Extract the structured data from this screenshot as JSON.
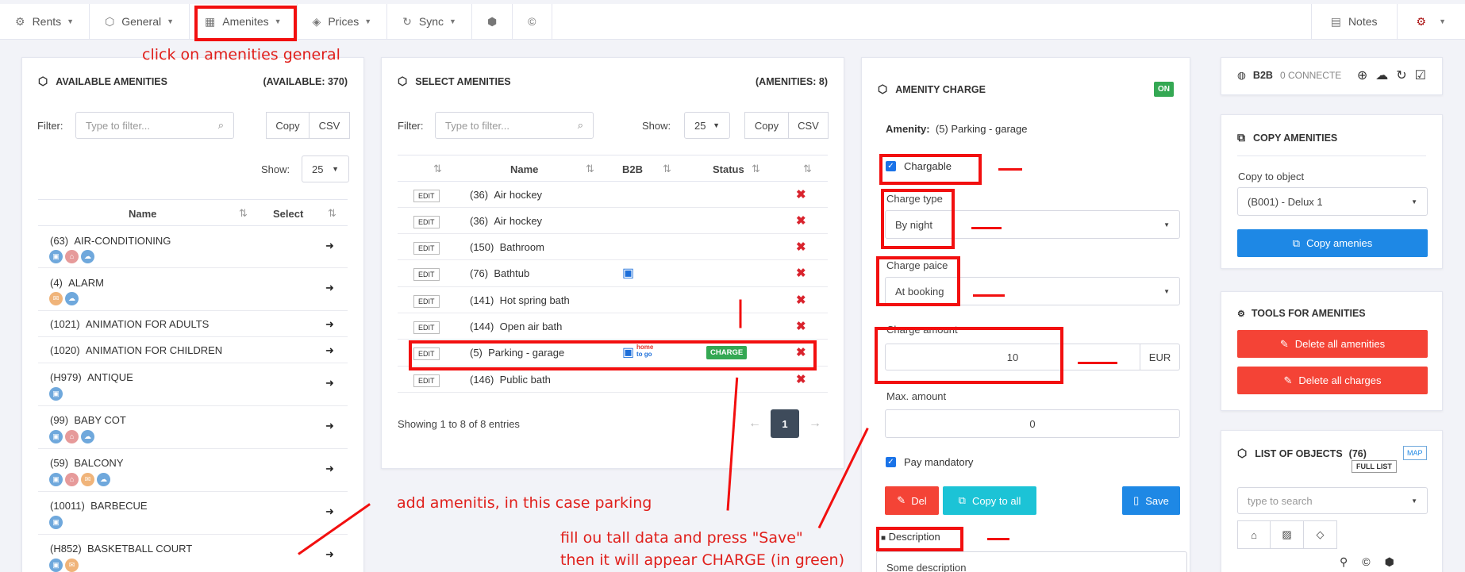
{
  "nav": {
    "rents": "Rents",
    "general": "General",
    "amenities": "Amenites",
    "prices": "Prices",
    "sync": "Sync",
    "notes": "Notes"
  },
  "available": {
    "title": "AVAILABLE AMENITIES",
    "count": "(AVAILABLE: 370)",
    "filter_label": "Filter:",
    "filter_placeholder": "Type to filter...",
    "copy": "Copy",
    "csv": "CSV",
    "show_label": "Show:",
    "show_value": "25",
    "col_name": "Name",
    "col_select": "Select",
    "rows": [
      {
        "code": "(63)",
        "name": "AIR-CONDITIONING"
      },
      {
        "code": "(4)",
        "name": "ALARM"
      },
      {
        "code": "(1021)",
        "name": "ANIMATION FOR ADULTS"
      },
      {
        "code": "(1020)",
        "name": "ANIMATION FOR CHILDREN"
      },
      {
        "code": "(H979)",
        "name": "ANTIQUE"
      },
      {
        "code": "(99)",
        "name": "BABY COT"
      },
      {
        "code": "(59)",
        "name": "BALCONY"
      },
      {
        "code": "(10011)",
        "name": "BARBECUE"
      },
      {
        "code": "(H852)",
        "name": "BASKETBALL COURT"
      }
    ]
  },
  "selected": {
    "title": "SELECT AMENITIES",
    "count": "(AMENITIES: 8)",
    "filter_label": "Filter:",
    "filter_placeholder": "Type to filter...",
    "show_label": "Show:",
    "show_value": "25",
    "copy": "Copy",
    "csv": "CSV",
    "col_name": "Name",
    "col_b2b": "B2B",
    "col_status": "Status",
    "edit": "EDIT",
    "rows": [
      {
        "code": "(36)",
        "name": "Air hockey"
      },
      {
        "code": "(36)",
        "name": "Air hockey"
      },
      {
        "code": "(150)",
        "name": "Bathroom"
      },
      {
        "code": "(76)",
        "name": "Bathtub"
      },
      {
        "code": "(141)",
        "name": "Hot spring bath"
      },
      {
        "code": "(144)",
        "name": "Open air bath"
      },
      {
        "code": "(5)",
        "name": "Parking - garage"
      },
      {
        "code": "(146)",
        "name": "Public bath"
      }
    ],
    "charge_badge": "CHARGE",
    "home_logo_top": "home",
    "home_logo_bottom": "to go",
    "showing": "Showing 1 to 8 of 8 entries",
    "page": "1"
  },
  "charge": {
    "title": "AMENITY CHARGE",
    "on": "ON",
    "amenity_label": "Amenity:",
    "amenity_value": "(5)  Parking - garage",
    "chargable": "Chargable",
    "charge_type_label": "Charge type",
    "charge_type_value": "By night",
    "charge_place_label": "Charge paice",
    "charge_place_value": "At booking",
    "charge_amount_label": "Charge amount",
    "charge_amount_value": "10",
    "currency": "EUR",
    "max_label": "Max. amount",
    "max_value": "0",
    "pay_mandatory": "Pay mandatory",
    "del": "Del",
    "copy_all": "Copy to all",
    "save": "Save",
    "description_label": "Description",
    "description_value": "Some description"
  },
  "b2b": {
    "label": "B2B",
    "connected": "0 CONNECTE"
  },
  "copy_amen": {
    "title": "COPY AMENITIES",
    "copy_to_label": "Copy to object",
    "copy_to_value": "(B001) - Delux 1",
    "button": "Copy amenies"
  },
  "tools": {
    "title": "TOOLS FOR AMENITIES",
    "delete_all": "Delete all amenities",
    "delete_charges": "Delete all charges"
  },
  "objects": {
    "title": "LIST OF OBJECTS",
    "count": "(76)",
    "map": "MAP",
    "full_list": "FULL LIST",
    "search_placeholder": "type to search"
  },
  "annotations": {
    "a1": "click on amenities general",
    "a2": "add amenitis, in this case parking",
    "a3_line1": "fill ou tall data and press \"Save\"",
    "a3_line2": "then it will appear CHARGE (in green)"
  },
  "colors": {
    "accent": "#1e88e5",
    "danger": "#f44336",
    "teal": "#1cc3d6",
    "green": "#34a853",
    "annot": "#f20f0f"
  }
}
